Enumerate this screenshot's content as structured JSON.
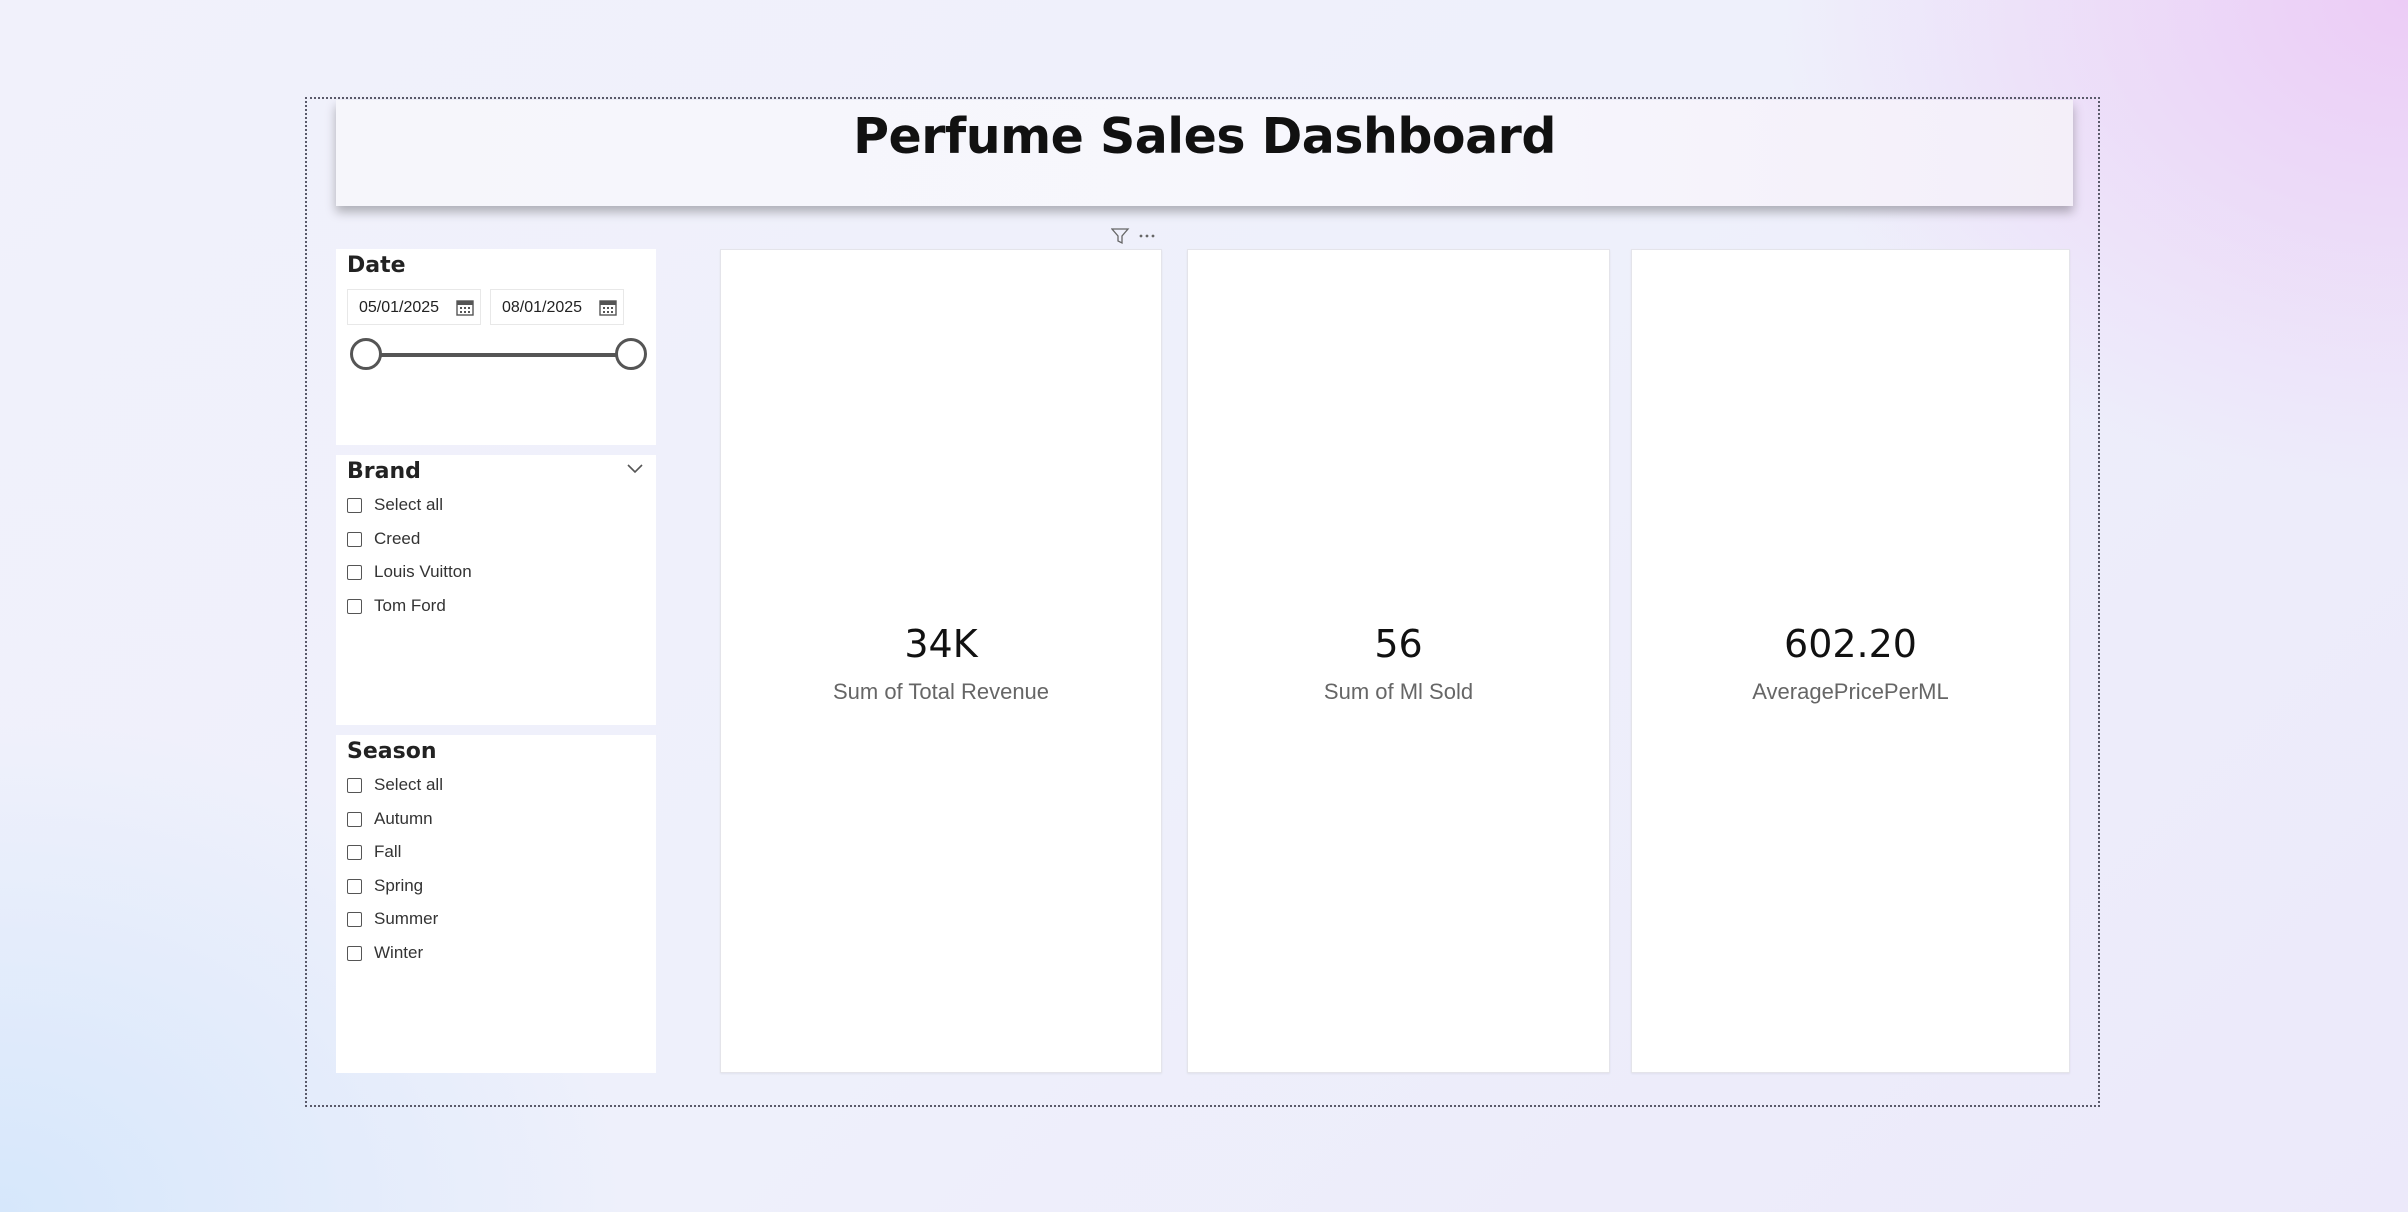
{
  "dashboard": {
    "title": "Perfume Sales Dashboard"
  },
  "date_slicer": {
    "title": "Date",
    "start": "05/01/2025",
    "end": "08/01/2025",
    "range_fraction": [
      0,
      1
    ]
  },
  "brand_slicer": {
    "title": "Brand",
    "options": [
      "Select all",
      "Creed",
      "Louis Vuitton",
      "Tom Ford"
    ]
  },
  "season_slicer": {
    "title": "Season",
    "options": [
      "Select all",
      "Autumn",
      "Fall",
      "Spring",
      "Summer",
      "Winter"
    ]
  },
  "cards": [
    {
      "value": "34K",
      "label": "Sum of Total Revenue"
    },
    {
      "value": "56",
      "label": "Sum of Ml Sold"
    },
    {
      "value": "602.20",
      "label": "AveragePricePerML"
    }
  ],
  "visual_header_icons": [
    "filter-icon",
    "more-options-icon"
  ]
}
